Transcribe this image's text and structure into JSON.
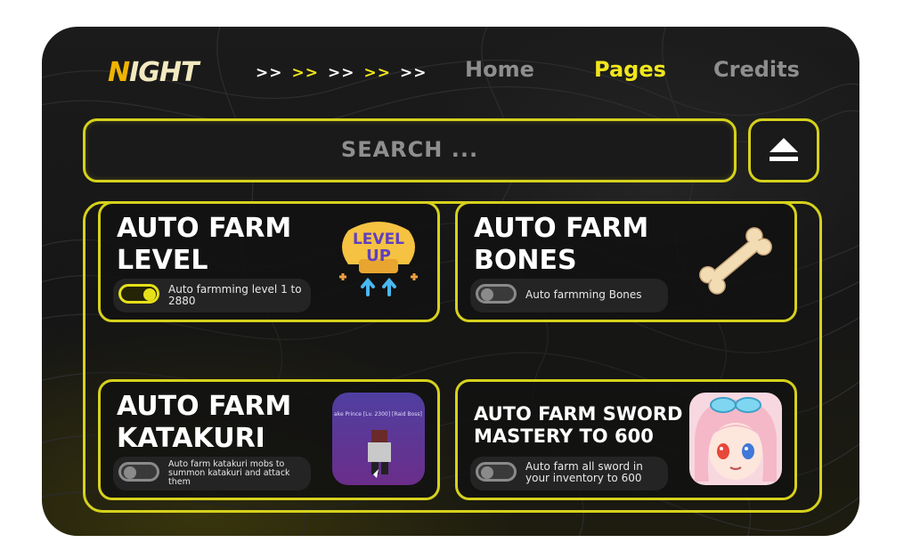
{
  "header": {
    "logo_first": "N",
    "logo_rest": "IGHT",
    "arrows": [
      {
        "text": ">>",
        "color": "#ffffff"
      },
      {
        "text": ">>",
        "color": "#f1e61c"
      },
      {
        "text": ">>",
        "color": "#ffffff"
      },
      {
        "text": ">>",
        "color": "#f1e61c"
      },
      {
        "text": ">>",
        "color": "#ffffff"
      }
    ],
    "nav": {
      "home": "Home",
      "pages": "Pages",
      "credits": "Credits"
    },
    "active_nav": "pages"
  },
  "search": {
    "placeholder": "SEARCH ..."
  },
  "eject_button": {
    "icon": "eject-icon"
  },
  "cards": [
    {
      "title_line1": "AUTO FARM",
      "title_line2": "LEVEL",
      "description": "Auto farmming level 1 to 2880",
      "toggle_on": true,
      "image_icon": "level-up-badge",
      "image_text_1": "LEVEL",
      "image_text_2": "UP"
    },
    {
      "title_line1": "AUTO FARM",
      "title_line2": "BONES",
      "description": "Auto farmming Bones",
      "toggle_on": false,
      "image_icon": "bone-icon"
    },
    {
      "title_line1": "AUTO FARM",
      "title_line2": "KATAKURI",
      "description": "Auto farm katakuri mobs to summon katakuri and attack them",
      "toggle_on": false,
      "image_icon": "katakuri-game-thumbnail",
      "image_caption": "ake Prince [Lv. 2300] [Raid Boss]"
    },
    {
      "title_line1": "AUTO FARM SWORD",
      "title_line2": "MASTERY TO 600",
      "description": "Auto farm all sword in your inventory to 600",
      "toggle_on": false,
      "image_icon": "anime-girl-avatar"
    }
  ],
  "colors": {
    "accent": "#d6d11c",
    "logo_accent": "#f0b400",
    "nav_inactive": "#8e8e8e",
    "nav_active": "#f1e61c",
    "window_bg": "#171717"
  }
}
